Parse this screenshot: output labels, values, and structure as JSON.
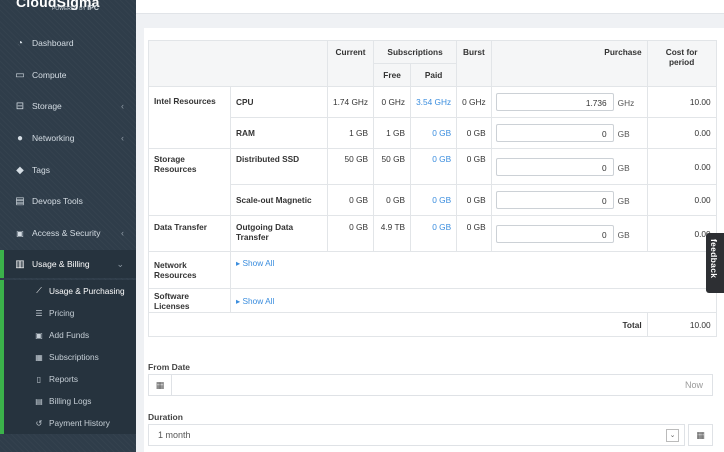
{
  "brand": {
    "name": "CloudSigma",
    "sub": "POWERED BY",
    "sub_logo": "IPC"
  },
  "sidebar": {
    "items": [
      {
        "label": "Dashboard",
        "icon": "dashboard-icon",
        "glyph": "◔",
        "chevron": false
      },
      {
        "label": "Compute",
        "icon": "monitor-icon",
        "glyph": "▭",
        "chevron": false
      },
      {
        "label": "Storage",
        "icon": "storage-icon",
        "glyph": "⊟",
        "chevron": true
      },
      {
        "label": "Networking",
        "icon": "globe-icon",
        "glyph": "●",
        "chevron": true
      },
      {
        "label": "Tags",
        "icon": "tags-icon",
        "glyph": "◆",
        "chevron": false
      },
      {
        "label": "Devops Tools",
        "icon": "devops-icon",
        "glyph": "▤",
        "chevron": false
      },
      {
        "label": "Access & Security",
        "icon": "lock-icon",
        "glyph": "🔒",
        "chevron": true
      },
      {
        "label": "Usage & Billing",
        "icon": "bar-chart-icon",
        "glyph": "▥",
        "chevron": true
      }
    ],
    "sub_items": [
      {
        "label": "Usage & Purchasing",
        "icon": "line-chart-icon",
        "glyph": "⟋"
      },
      {
        "label": "Pricing",
        "icon": "list-icon",
        "glyph": "☰"
      },
      {
        "label": "Add Funds",
        "icon": "money-icon",
        "glyph": "▣"
      },
      {
        "label": "Subscriptions",
        "icon": "calendar-icon",
        "glyph": "▦"
      },
      {
        "label": "Reports",
        "icon": "file-icon",
        "glyph": "▯"
      },
      {
        "label": "Billing Logs",
        "icon": "logs-icon",
        "glyph": "▤"
      },
      {
        "label": "Payment History",
        "icon": "history-icon",
        "glyph": "↺"
      }
    ]
  },
  "table": {
    "headers": {
      "current": "Current",
      "subscriptions": "Subscriptions",
      "free": "Free",
      "paid": "Paid",
      "burst": "Burst",
      "purchase": "Purchase",
      "cost": "Cost for period"
    },
    "groups": {
      "intel": "Intel Resources",
      "storage": "Storage Resources",
      "transfer": "Data Transfer",
      "network": "Network Resources",
      "licenses": "Software Licenses"
    },
    "rows": {
      "cpu": {
        "name": "CPU",
        "current": "1.74 GHz",
        "free": "0 GHz",
        "paid": "3.54 GHz",
        "burst": "0 GHz",
        "purchase": "1.736",
        "unit": "GHz",
        "cost": "10.00"
      },
      "ram": {
        "name": "RAM",
        "current": "1 GB",
        "free": "1 GB",
        "paid": "0 GB",
        "burst": "0 GB",
        "purchase": "0",
        "unit": "GB",
        "cost": "0.00"
      },
      "ssd": {
        "name": "Distributed SSD",
        "current": "50 GB",
        "free": "50 GB",
        "paid": "0 GB",
        "burst": "0 GB",
        "purchase": "0",
        "unit": "GB",
        "cost": "0.00"
      },
      "magnetic": {
        "name": "Scale-out Magnetic",
        "current": "0 GB",
        "free": "0 GB",
        "paid": "0 GB",
        "burst": "0 GB",
        "purchase": "0",
        "unit": "GB",
        "cost": "0.00"
      },
      "outgoing": {
        "name": "Outgoing Data Transfer",
        "current": "0 GB",
        "free": "4.9 TB",
        "paid": "0 GB",
        "burst": "0 GB",
        "purchase": "0",
        "unit": "GB",
        "cost": "0.00"
      }
    },
    "show_all": "Show All",
    "total_label": "Total",
    "total_value": "10.00"
  },
  "form": {
    "from_date_label": "From Date",
    "from_date_value": "Now",
    "duration_label": "Duration",
    "duration_value": "1 month"
  },
  "feedback": "feedback",
  "colors": {
    "sidebar": "#2f3d4a",
    "accent": "#3bb24a",
    "link": "#3a8dde"
  }
}
